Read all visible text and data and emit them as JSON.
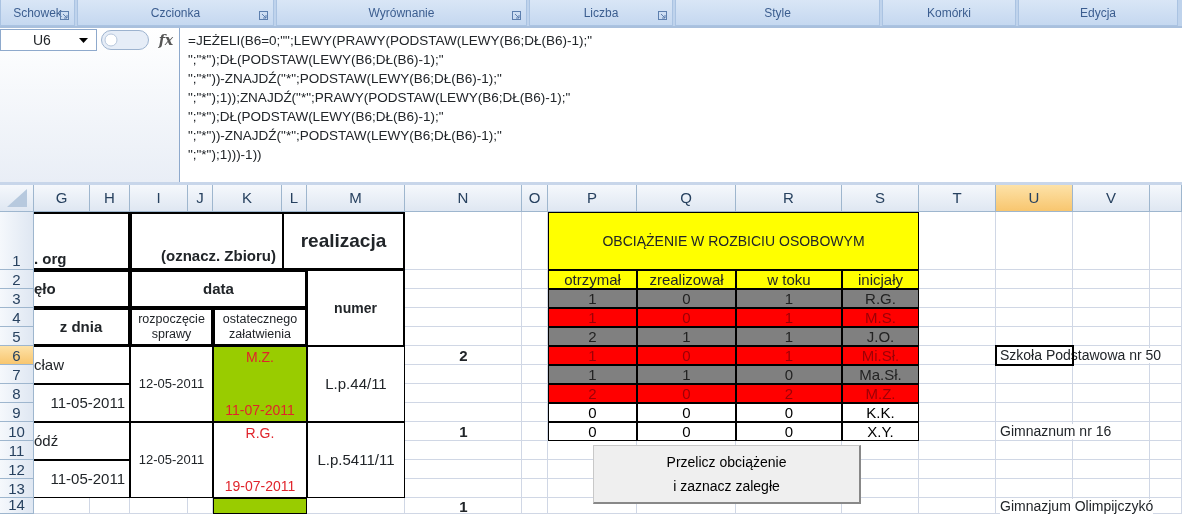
{
  "ribbon": {
    "groups": [
      {
        "label": "Schowek",
        "launcher": true
      },
      {
        "label": "Czcionka",
        "launcher": true
      },
      {
        "label": "Wyrównanie",
        "launcher": true
      },
      {
        "label": "Liczba",
        "launcher": true
      },
      {
        "label": "Style",
        "launcher": false
      },
      {
        "label": "Komórki",
        "launcher": false
      },
      {
        "label": "Edycja",
        "launcher": false
      }
    ]
  },
  "formula_bar": {
    "name_box": "U6",
    "function_label": "fx",
    "formula_lines": [
      "=JEŻELI(B6=0;\"\";LEWY(PRAWY(PODSTAW(LEWY(B6;DŁ(B6)-1);\"",
      "\";\"*\");DŁ(PODSTAW(LEWY(B6;DŁ(B6)-1);\"",
      "\";\"*\"))-ZNAJDŹ(\"*\";PODSTAW(LEWY(B6;DŁ(B6)-1);\"",
      "\";\"*\");1));ZNAJDŹ(\"*\";PRAWY(PODSTAW(LEWY(B6;DŁ(B6)-1);\"",
      "\";\"*\");DŁ(PODSTAW(LEWY(B6;DŁ(B6)-1);\"",
      "\";\"*\"))-ZNAJDŹ(\"*\";PODSTAW(LEWY(B6;DŁ(B6)-1);\"",
      "\";\"*\");1)))-1))"
    ]
  },
  "columns": [
    {
      "label": "G",
      "selected": false
    },
    {
      "label": "H",
      "selected": false
    },
    {
      "label": "I",
      "selected": false
    },
    {
      "label": "J",
      "selected": false
    },
    {
      "label": "K",
      "selected": false
    },
    {
      "label": "L",
      "selected": false
    },
    {
      "label": "M",
      "selected": false
    },
    {
      "label": "N",
      "selected": false
    },
    {
      "label": "O",
      "selected": false
    },
    {
      "label": "P",
      "selected": false
    },
    {
      "label": "Q",
      "selected": false
    },
    {
      "label": "R",
      "selected": false
    },
    {
      "label": "S",
      "selected": false
    },
    {
      "label": "T",
      "selected": false
    },
    {
      "label": "U",
      "selected": true
    },
    {
      "label": "V",
      "selected": false
    }
  ],
  "rows": [
    {
      "label": "1",
      "selected": false
    },
    {
      "label": "2",
      "selected": false
    },
    {
      "label": "3",
      "selected": false
    },
    {
      "label": "4",
      "selected": false
    },
    {
      "label": "5",
      "selected": false
    },
    {
      "label": "6",
      "selected": true
    },
    {
      "label": "7",
      "selected": false
    },
    {
      "label": "8",
      "selected": false
    },
    {
      "label": "9",
      "selected": false
    },
    {
      "label": "10",
      "selected": false
    },
    {
      "label": "11",
      "selected": false
    },
    {
      "label": "12",
      "selected": false
    },
    {
      "label": "13",
      "selected": false
    },
    {
      "label": "14",
      "selected": false
    }
  ],
  "register": {
    "header": {
      "org": ". org",
      "marking": "(oznacz. Zbioru)",
      "realization": "realizacja",
      "received": "ęło",
      "date": "data",
      "number": "numer",
      "from_date": "z dnia",
      "start": "rozpoczęcie sprawy",
      "final": "ostatecznego załatwienia"
    },
    "records": [
      {
        "place": "cław",
        "received_date": "11-05-2011",
        "start_date": "12-05-2011",
        "assignee": "M.Z.",
        "end_date": "11-07-2011",
        "number": "L.p.44/11",
        "count": "2",
        "school": "Szkoła Podstawowa nr 50",
        "completed": true
      },
      {
        "place": "ódź",
        "received_date": "11-05-2011",
        "start_date": "12-05-2011",
        "assignee": "R.G.",
        "end_date": "19-07-2011",
        "number": "L.p.5411/11",
        "count": "1",
        "school": "Gimnaznum nr 16",
        "completed": false
      },
      {
        "count": "1",
        "school": "Gimnazjum Olimpijczykó",
        "completed": true
      }
    ]
  },
  "workload": {
    "title": "OBCIĄŻENIE W ROZBICIU OSOBOWYM",
    "columns": [
      "otrzymał",
      "zrealizował",
      "w toku",
      "inicjały"
    ],
    "rows": [
      {
        "kind": "normal",
        "cells": [
          "1",
          "0",
          "1",
          "R.G."
        ]
      },
      {
        "kind": "overdue",
        "cells": [
          "1",
          "0",
          "1",
          "M.S."
        ]
      },
      {
        "kind": "normal",
        "cells": [
          "2",
          "1",
          "1",
          "J.O."
        ]
      },
      {
        "kind": "overdue",
        "cells": [
          "1",
          "0",
          "1",
          "Mi.Sł."
        ]
      },
      {
        "kind": "normal",
        "cells": [
          "1",
          "1",
          "0",
          "Ma.Sł."
        ]
      },
      {
        "kind": "overdue",
        "cells": [
          "2",
          "0",
          "2",
          "M.Z."
        ]
      },
      {
        "kind": "empty",
        "cells": [
          "0",
          "0",
          "0",
          "K.K."
        ]
      },
      {
        "kind": "empty",
        "cells": [
          "0",
          "0",
          "0",
          "X.Y."
        ]
      }
    ]
  },
  "recalc_button": {
    "lines": [
      "Przelicz obciążenie",
      "i zaznacz zaległe"
    ]
  }
}
